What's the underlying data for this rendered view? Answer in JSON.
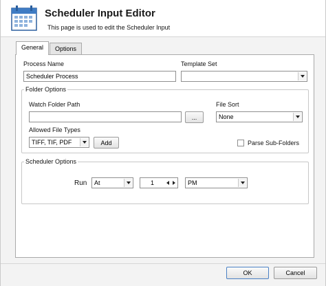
{
  "header": {
    "title": "Scheduler Input Editor",
    "subtitle": "This page is used to edit the Scheduler Input",
    "icon": "calendar-icon"
  },
  "tabs": [
    {
      "label": "General",
      "active": true
    },
    {
      "label": "Options",
      "active": false
    }
  ],
  "general": {
    "process_name_label": "Process Name",
    "process_name_value": "Scheduler Process",
    "template_set_label": "Template Set",
    "template_set_value": ""
  },
  "folder_options": {
    "title": "Folder Options",
    "watch_folder_label": "Watch Folder Path",
    "watch_folder_value": "",
    "browse_label": "...",
    "file_sort_label": "File Sort",
    "file_sort_value": "None",
    "allowed_types_label": "Allowed File Types",
    "allowed_types_value": "TIFF, TIF, PDF",
    "add_label": "Add",
    "parse_subfolders_label": "Parse Sub-Folders",
    "parse_subfolders_checked": false
  },
  "scheduler_options": {
    "title": "Scheduler Options",
    "run_label": "Run",
    "run_mode_value": "At",
    "hour_value": "1",
    "ampm_value": "PM"
  },
  "footer": {
    "ok_label": "OK",
    "cancel_label": "Cancel"
  }
}
